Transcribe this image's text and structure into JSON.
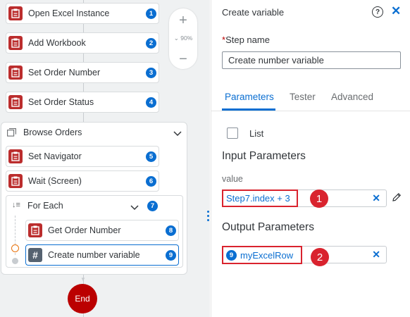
{
  "canvas": {
    "zoom": {
      "plus": "+",
      "level": "90%",
      "minus": "−"
    },
    "steps": [
      {
        "label": "Open Excel Instance",
        "number": "1"
      },
      {
        "label": "Add Workbook",
        "number": "2"
      },
      {
        "label": "Set Order Number",
        "number": "3"
      },
      {
        "label": "Set Order Status",
        "number": "4"
      }
    ],
    "browse_group": {
      "title": "Browse Orders",
      "steps": [
        {
          "label": "Set Navigator",
          "number": "5"
        },
        {
          "label": "Wait (Screen)",
          "number": "6"
        }
      ],
      "for_each": {
        "title": "For Each",
        "number": "7",
        "steps": [
          {
            "label": "Get Order Number",
            "number": "8"
          },
          {
            "label": "Create number variable",
            "number": "9"
          }
        ]
      }
    },
    "end_label": "End"
  },
  "panel": {
    "title": "Create variable",
    "step_name": {
      "required_mark": "*",
      "label": "Step name",
      "value": "Create number variable"
    },
    "tabs": [
      {
        "label": "Parameters",
        "active": true
      },
      {
        "label": "Tester",
        "active": false
      },
      {
        "label": "Advanced",
        "active": false
      }
    ],
    "list_checkbox": {
      "label": "List",
      "checked": false
    },
    "input_parameters": {
      "title": "Input Parameters",
      "param_label": "value",
      "expression": "Step7.index + 3",
      "callout": "1"
    },
    "output_parameters": {
      "title": "Output Parameters",
      "variable_number": "9",
      "variable_name": "myExcelRow",
      "callout": "2"
    }
  },
  "colors": {
    "accent": "#0a6ed1",
    "activity_icon": "#bb2d2d",
    "end_node": "#bb0000",
    "annotation": "#d9232e"
  }
}
